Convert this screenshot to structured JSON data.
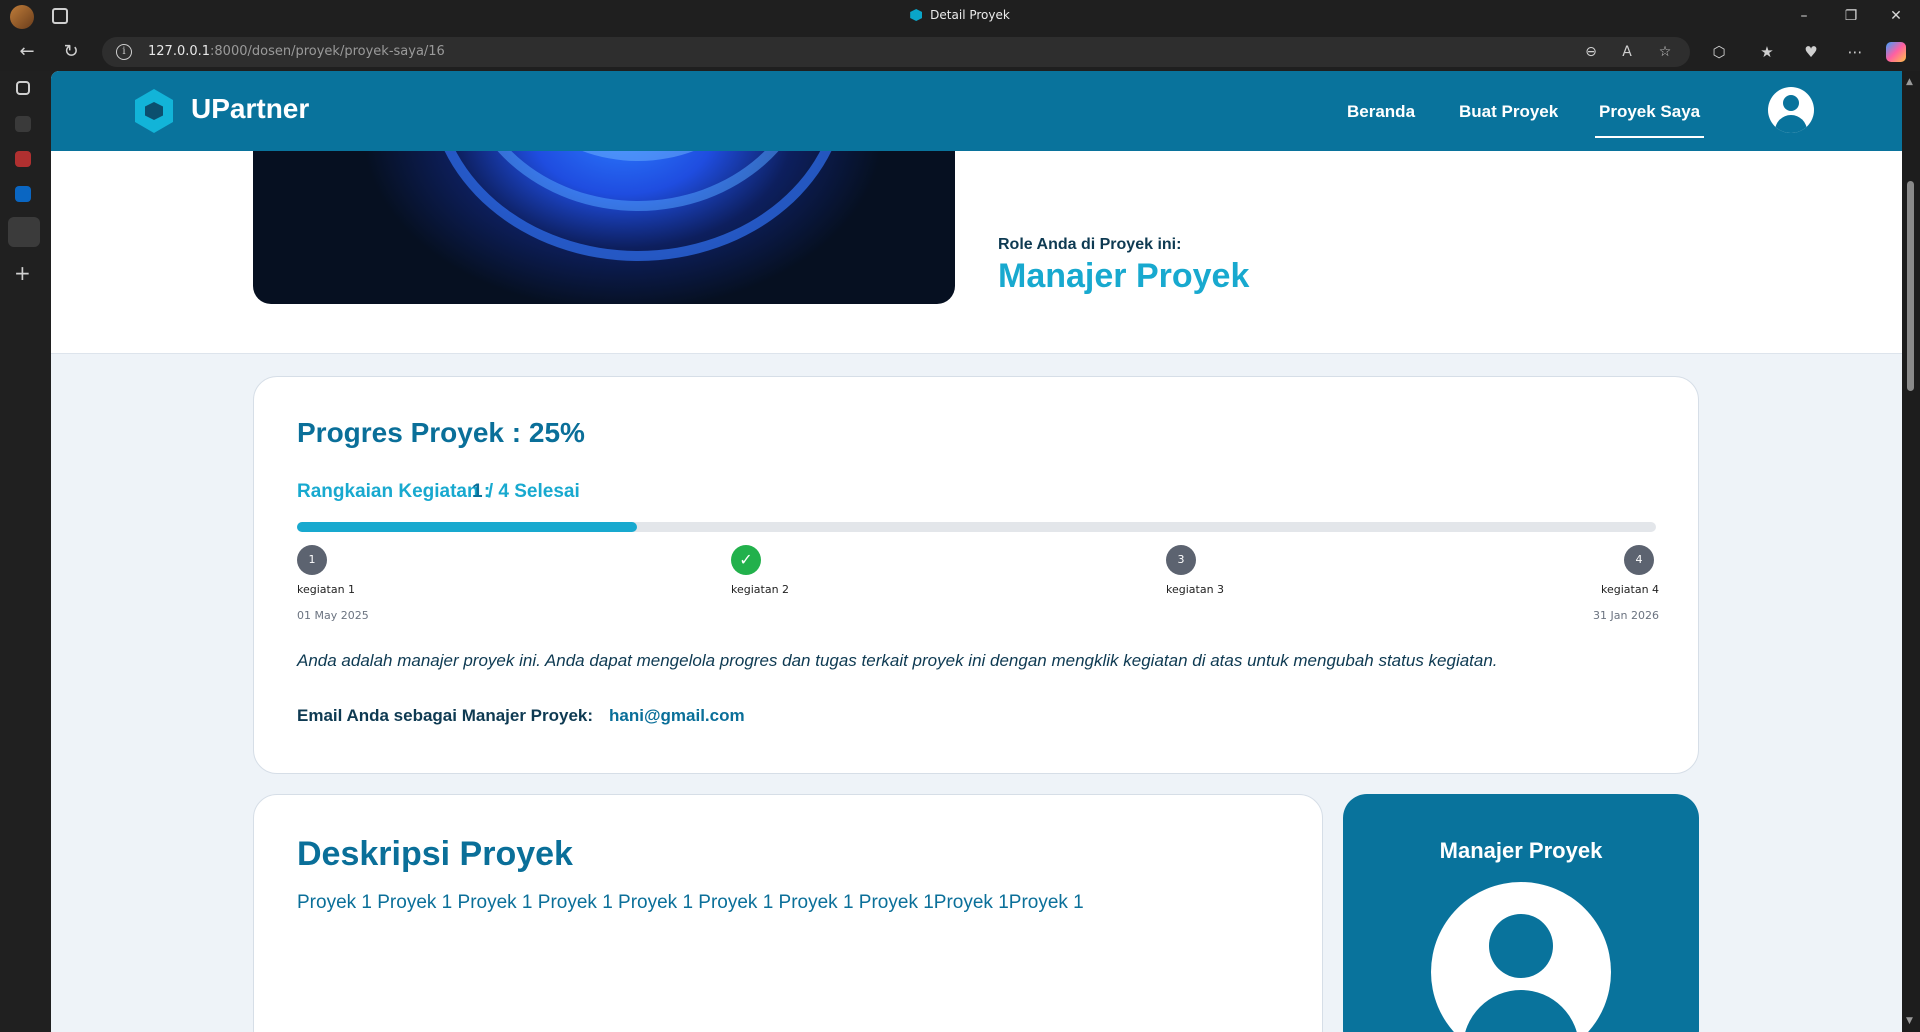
{
  "browser": {
    "tab_title": "Detail Proyek",
    "url_host": "127.0.0.1",
    "url_path": ":8000/dosen/proyek/proyek-saya/16"
  },
  "navbar": {
    "brand": "UPartner",
    "links": [
      "Beranda",
      "Buat Proyek",
      "Proyek Saya"
    ],
    "active": "Proyek Saya"
  },
  "hero": {
    "role_label": "Role Anda di Proyek ini:",
    "role_value": "Manajer Proyek"
  },
  "progress": {
    "title": "Progres Proyek : 25%",
    "percent": 25,
    "steps_label": "Rangkaian Kegiatan :",
    "steps_done": "1",
    "steps_total": " / 4 Selesai",
    "steps": [
      {
        "marker": "1",
        "name": "kegiatan 1",
        "done": false
      },
      {
        "marker": "✓",
        "name": "kegiatan 2",
        "done": true
      },
      {
        "marker": "3",
        "name": "kegiatan 3",
        "done": false
      },
      {
        "marker": "4",
        "name": "kegiatan 4",
        "done": false
      }
    ],
    "start_date": "01 May 2025",
    "end_date": "31 Jan 2026",
    "note": "Anda adalah manajer proyek ini. Anda dapat mengelola progres dan tugas terkait proyek ini dengan mengklik kegiatan di atas untuk mengubah status kegiatan.",
    "email_label": "Email Anda sebagai Manajer Proyek:",
    "email_value": "hani@gmail.com"
  },
  "description": {
    "title": "Deskripsi Proyek",
    "text": "Proyek 1 Proyek 1 Proyek 1 Proyek 1 Proyek 1 Proyek 1 Proyek 1 Proyek 1Proyek 1Proyek 1"
  },
  "manager": {
    "title": "Manajer Proyek"
  }
}
